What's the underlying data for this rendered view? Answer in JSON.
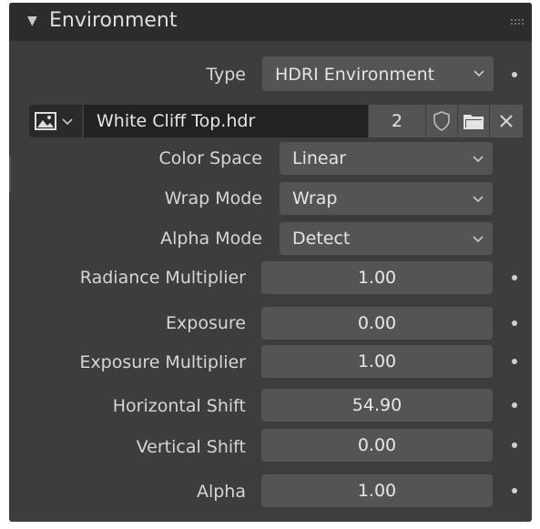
{
  "panel": {
    "title": "Environment"
  },
  "type_row": {
    "label": "Type",
    "value": "HDRI Environment"
  },
  "image": {
    "filename": "White Cliff Top.hdr",
    "users": "2"
  },
  "color_space": {
    "label": "Color Space",
    "value": "Linear"
  },
  "wrap_mode": {
    "label": "Wrap Mode",
    "value": "Wrap"
  },
  "alpha_mode": {
    "label": "Alpha Mode",
    "value": "Detect"
  },
  "radiance_multiplier": {
    "label": "Radiance Multiplier",
    "value": "1.00"
  },
  "exposure": {
    "label": "Exposure",
    "value": "0.00"
  },
  "exposure_multiplier": {
    "label": "Exposure Multiplier",
    "value": "1.00"
  },
  "horizontal_shift": {
    "label": "Horizontal Shift",
    "value": "54.90"
  },
  "vertical_shift": {
    "label": "Vertical Shift",
    "value": "0.00"
  },
  "alpha": {
    "label": "Alpha",
    "value": "1.00"
  },
  "icons": {
    "collapse": "triangle-down-icon",
    "drag": "drag-handle-icon",
    "image_type": "image-icon",
    "fake_user": "shield-icon",
    "open_file": "folder-icon",
    "unlink": "close-icon",
    "dropdown": "chevron-down-icon",
    "keyframe": "keyframe-dot-icon"
  },
  "colors": {
    "panel_bg": "#3d3d3d",
    "header_bg": "#2c2c2c",
    "field_bg": "#545454",
    "dark_field_bg": "#222222",
    "text": "#d6d6d6"
  }
}
